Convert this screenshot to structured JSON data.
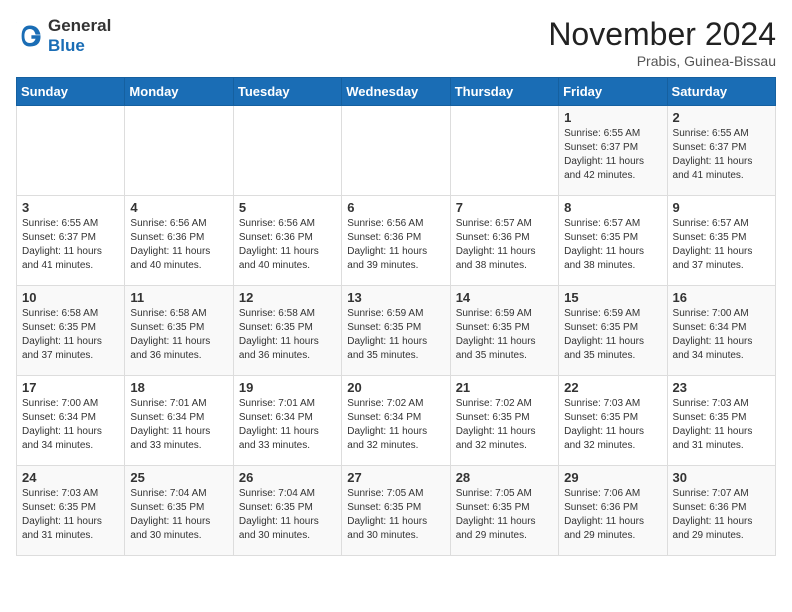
{
  "header": {
    "logo_general": "General",
    "logo_blue": "Blue",
    "month_title": "November 2024",
    "location": "Prabis, Guinea-Bissau"
  },
  "weekdays": [
    "Sunday",
    "Monday",
    "Tuesday",
    "Wednesday",
    "Thursday",
    "Friday",
    "Saturday"
  ],
  "weeks": [
    [
      {
        "day": "",
        "info": ""
      },
      {
        "day": "",
        "info": ""
      },
      {
        "day": "",
        "info": ""
      },
      {
        "day": "",
        "info": ""
      },
      {
        "day": "",
        "info": ""
      },
      {
        "day": "1",
        "info": "Sunrise: 6:55 AM\nSunset: 6:37 PM\nDaylight: 11 hours and 42 minutes."
      },
      {
        "day": "2",
        "info": "Sunrise: 6:55 AM\nSunset: 6:37 PM\nDaylight: 11 hours and 41 minutes."
      }
    ],
    [
      {
        "day": "3",
        "info": "Sunrise: 6:55 AM\nSunset: 6:37 PM\nDaylight: 11 hours and 41 minutes."
      },
      {
        "day": "4",
        "info": "Sunrise: 6:56 AM\nSunset: 6:36 PM\nDaylight: 11 hours and 40 minutes."
      },
      {
        "day": "5",
        "info": "Sunrise: 6:56 AM\nSunset: 6:36 PM\nDaylight: 11 hours and 40 minutes."
      },
      {
        "day": "6",
        "info": "Sunrise: 6:56 AM\nSunset: 6:36 PM\nDaylight: 11 hours and 39 minutes."
      },
      {
        "day": "7",
        "info": "Sunrise: 6:57 AM\nSunset: 6:36 PM\nDaylight: 11 hours and 38 minutes."
      },
      {
        "day": "8",
        "info": "Sunrise: 6:57 AM\nSunset: 6:35 PM\nDaylight: 11 hours and 38 minutes."
      },
      {
        "day": "9",
        "info": "Sunrise: 6:57 AM\nSunset: 6:35 PM\nDaylight: 11 hours and 37 minutes."
      }
    ],
    [
      {
        "day": "10",
        "info": "Sunrise: 6:58 AM\nSunset: 6:35 PM\nDaylight: 11 hours and 37 minutes."
      },
      {
        "day": "11",
        "info": "Sunrise: 6:58 AM\nSunset: 6:35 PM\nDaylight: 11 hours and 36 minutes."
      },
      {
        "day": "12",
        "info": "Sunrise: 6:58 AM\nSunset: 6:35 PM\nDaylight: 11 hours and 36 minutes."
      },
      {
        "day": "13",
        "info": "Sunrise: 6:59 AM\nSunset: 6:35 PM\nDaylight: 11 hours and 35 minutes."
      },
      {
        "day": "14",
        "info": "Sunrise: 6:59 AM\nSunset: 6:35 PM\nDaylight: 11 hours and 35 minutes."
      },
      {
        "day": "15",
        "info": "Sunrise: 6:59 AM\nSunset: 6:35 PM\nDaylight: 11 hours and 35 minutes."
      },
      {
        "day": "16",
        "info": "Sunrise: 7:00 AM\nSunset: 6:34 PM\nDaylight: 11 hours and 34 minutes."
      }
    ],
    [
      {
        "day": "17",
        "info": "Sunrise: 7:00 AM\nSunset: 6:34 PM\nDaylight: 11 hours and 34 minutes."
      },
      {
        "day": "18",
        "info": "Sunrise: 7:01 AM\nSunset: 6:34 PM\nDaylight: 11 hours and 33 minutes."
      },
      {
        "day": "19",
        "info": "Sunrise: 7:01 AM\nSunset: 6:34 PM\nDaylight: 11 hours and 33 minutes."
      },
      {
        "day": "20",
        "info": "Sunrise: 7:02 AM\nSunset: 6:34 PM\nDaylight: 11 hours and 32 minutes."
      },
      {
        "day": "21",
        "info": "Sunrise: 7:02 AM\nSunset: 6:35 PM\nDaylight: 11 hours and 32 minutes."
      },
      {
        "day": "22",
        "info": "Sunrise: 7:03 AM\nSunset: 6:35 PM\nDaylight: 11 hours and 32 minutes."
      },
      {
        "day": "23",
        "info": "Sunrise: 7:03 AM\nSunset: 6:35 PM\nDaylight: 11 hours and 31 minutes."
      }
    ],
    [
      {
        "day": "24",
        "info": "Sunrise: 7:03 AM\nSunset: 6:35 PM\nDaylight: 11 hours and 31 minutes."
      },
      {
        "day": "25",
        "info": "Sunrise: 7:04 AM\nSunset: 6:35 PM\nDaylight: 11 hours and 30 minutes."
      },
      {
        "day": "26",
        "info": "Sunrise: 7:04 AM\nSunset: 6:35 PM\nDaylight: 11 hours and 30 minutes."
      },
      {
        "day": "27",
        "info": "Sunrise: 7:05 AM\nSunset: 6:35 PM\nDaylight: 11 hours and 30 minutes."
      },
      {
        "day": "28",
        "info": "Sunrise: 7:05 AM\nSunset: 6:35 PM\nDaylight: 11 hours and 29 minutes."
      },
      {
        "day": "29",
        "info": "Sunrise: 7:06 AM\nSunset: 6:36 PM\nDaylight: 11 hours and 29 minutes."
      },
      {
        "day": "30",
        "info": "Sunrise: 7:07 AM\nSunset: 6:36 PM\nDaylight: 11 hours and 29 minutes."
      }
    ]
  ]
}
